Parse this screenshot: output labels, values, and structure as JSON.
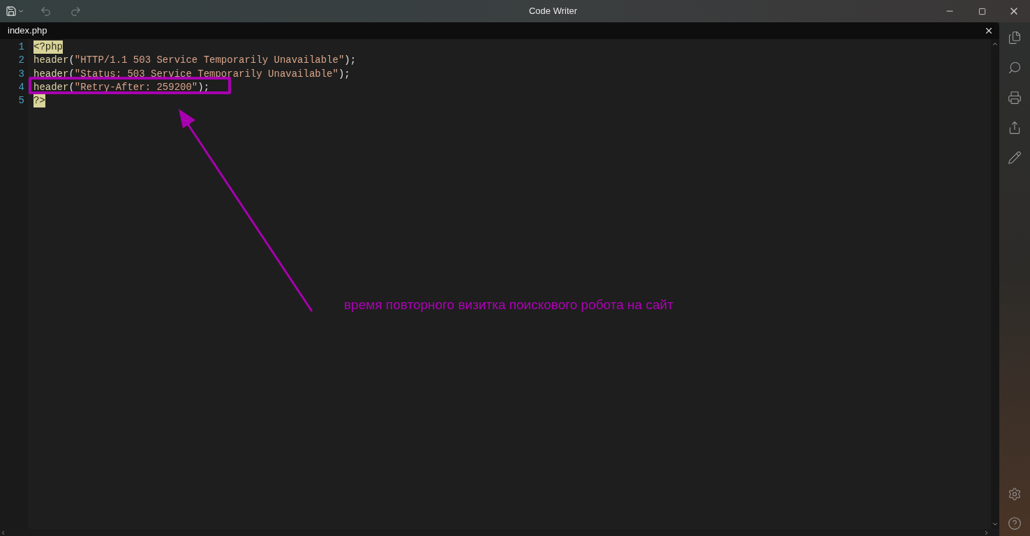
{
  "window": {
    "title": "Code Writer"
  },
  "tabs": [
    {
      "label": "index.php",
      "selected": true
    }
  ],
  "editor": {
    "lines": [
      {
        "number": "1",
        "tokens": [
          {
            "kind": "tag",
            "text": "<?php"
          }
        ]
      },
      {
        "number": "2",
        "tokens": [
          {
            "kind": "func",
            "text": "header"
          },
          {
            "kind": "punct",
            "text": "("
          },
          {
            "kind": "string",
            "text": "\"HTTP/1.1 503 Service Temporarily Unavailable\""
          },
          {
            "kind": "punct",
            "text": ");"
          }
        ]
      },
      {
        "number": "3",
        "tokens": [
          {
            "kind": "func",
            "text": "header"
          },
          {
            "kind": "punct",
            "text": "("
          },
          {
            "kind": "string",
            "text": "\"Status: 503 Service Temporarily Unavailable\""
          },
          {
            "kind": "punct",
            "text": ");"
          }
        ]
      },
      {
        "number": "4",
        "tokens": [
          {
            "kind": "func",
            "text": "header"
          },
          {
            "kind": "punct",
            "text": "("
          },
          {
            "kind": "string",
            "text": "\"Retry-After: 259200\""
          },
          {
            "kind": "punct",
            "text": ");"
          }
        ]
      },
      {
        "number": "5",
        "tokens": [
          {
            "kind": "tag",
            "text": "?>"
          }
        ]
      }
    ]
  },
  "annotation": {
    "caption": "время повторного визитка поискового робота на сайт"
  }
}
